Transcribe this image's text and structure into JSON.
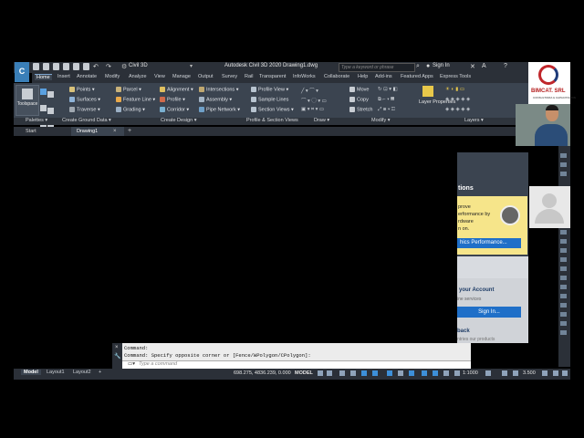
{
  "app": {
    "title": "Autodesk Civil 3D 2020   Drawing1.dwg",
    "workspace": "Civil 3D",
    "search_placeholder": "Type a keyword or phrase",
    "sign_in": "Sign In",
    "help": "?"
  },
  "ribbon_tabs": [
    "Home",
    "Insert",
    "Annotate",
    "Modify",
    "Analyze",
    "View",
    "Manage",
    "Output",
    "Survey",
    "Rail",
    "Transparent",
    "InfoWorks",
    "Collaborate",
    "Help",
    "Add-ins",
    "Featured Apps",
    "Express Tools"
  ],
  "ribbon": {
    "toolspace": "Toolspace",
    "ground": [
      "Points",
      "Surfaces",
      "Traverse"
    ],
    "design1": [
      "Parcel",
      "Feature Line",
      "Grading"
    ],
    "design2": [
      "Alignment",
      "Profile",
      "Corridor"
    ],
    "design3": [
      "Intersections",
      "Assembly",
      "Pipe Network"
    ],
    "profile_views": [
      "Profile View",
      "Sample Lines",
      "Section Views"
    ],
    "modify": [
      "Move",
      "Copy",
      "Stretch"
    ],
    "layer_properties": "Layer Properties",
    "panels": [
      "Palettes",
      "Create Ground Data",
      "Create Design",
      "Profile & Section Views",
      "Draw",
      "Modify",
      "Layers"
    ]
  },
  "file_tabs": {
    "start": "Start",
    "drawing": "Drawing1"
  },
  "side_panel": {
    "title": "tions",
    "text_lines": [
      "prove",
      "erformance by",
      "rdware",
      "n on."
    ],
    "graphics_button": "hics Performance...",
    "account_title": "your Account",
    "online_services": "ine services",
    "sign_in_button": "Sign In...",
    "feedback": "back",
    "feedback_sub": "ntries our products"
  },
  "webcam": {
    "company": "BIMCAT. SRL",
    "tagline": "CONSULTORIA & CAPACITACION"
  },
  "command": {
    "line1": "Command:",
    "line2": "Command: Specify opposite corner or [Fence/WPolygon/CPolygon]:",
    "placeholder": "Type a command"
  },
  "status": {
    "layout_tabs": [
      "Model",
      "Layout1",
      "Layout2"
    ],
    "coords": "698.275, 4836.239, 0.000",
    "model": "MODEL",
    "scale": "1:1000",
    "zoom": "3.500"
  },
  "colors": {
    "accent": "#1f6fc8",
    "ribbon": "#3b4450",
    "titlebar": "#2b3038",
    "yellow": "#f6e58a"
  }
}
